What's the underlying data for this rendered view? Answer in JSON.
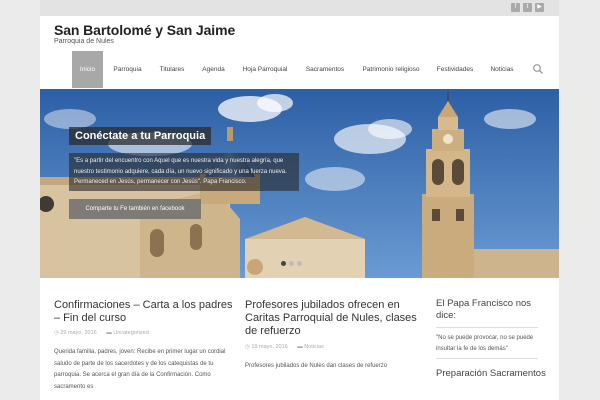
{
  "site": {
    "title": "San Bartolomé y San Jaime",
    "description": "Parroquia de Nules"
  },
  "social_icons": [
    "facebook-icon",
    "twitter-icon",
    "youtube-icon"
  ],
  "nav": {
    "items": [
      {
        "label": "Inicio",
        "active": true
      },
      {
        "label": "Parroquia",
        "active": false
      },
      {
        "label": "Titulares",
        "active": false
      },
      {
        "label": "Agenda",
        "active": false
      },
      {
        "label": "Hoja Parroquial",
        "active": false
      },
      {
        "label": "Sacramentos",
        "active": false
      },
      {
        "label": "Patrimonio religioso",
        "active": false
      },
      {
        "label": "Festividades",
        "active": false
      },
      {
        "label": "Noticias",
        "active": false
      }
    ],
    "search_icon": "search-icon"
  },
  "slider": {
    "title": "Conéctate a tu Parroquia",
    "text": "\"Es a partir del encuentro con Aquel que es nuestra vida y nuestra alegría, que nuestro testimonio adquiere, cada día, un nuevo significado y una fuerza nueva. Permaneced en Jesús, permanecer con Jesús\". Papa Francisco.",
    "button_label": "Comparte tu Fe también en facebook",
    "dots": 3,
    "active_dot": 1
  },
  "posts": [
    {
      "title": "Confirmaciones – Carta a los padres – Fin del curso",
      "date": "29 mayo, 2016",
      "category": "Uncategorized",
      "excerpt": "Querida familia, padres, joven: Recibe en primer lugar un cordial saludo de parte de los sacerdotes y de los catequistas de tu parroquia. Se acerca el gran día de la Confirmación. Como sacramento es"
    },
    {
      "title": "Profesores jubilados ofrecen en Caritas Parroquial de Nules, clases de refuerzo",
      "date": "19 mayo, 2016",
      "category": "Noticias",
      "excerpt": "Profesores jubilados de Nules dan clases de refuerzo"
    }
  ],
  "sidebar": {
    "widget1_title": "El Papa Francisco nos dice:",
    "widget1_text": "\"No se puede provocar, no se puede insultar la fe de los demás\"",
    "widget2_title": "Preparación Sacramentos"
  },
  "colors": {
    "background": "#ebebeb",
    "nav_active": "#a8a8a8",
    "sky": "#3f72b8",
    "stone": "#c9ab7e"
  }
}
